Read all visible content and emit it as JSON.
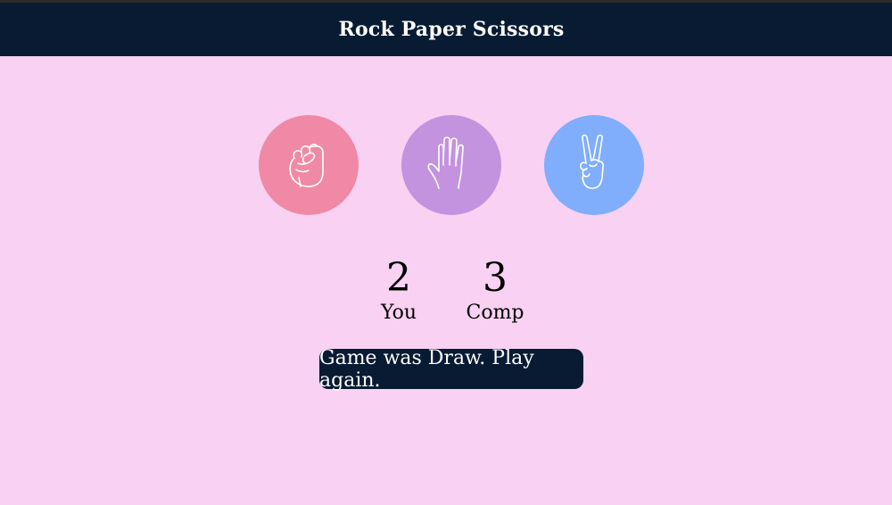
{
  "header": {
    "title": "Rock Paper Scissors"
  },
  "choices": [
    {
      "id": "rock",
      "icon": "fist-icon",
      "color": "#f089a5"
    },
    {
      "id": "paper",
      "icon": "open-hand-icon",
      "color": "#c393df"
    },
    {
      "id": "scissors",
      "icon": "peace-hand-icon",
      "color": "#80aefc"
    }
  ],
  "scoreboard": {
    "you": {
      "value": "2",
      "label": "You"
    },
    "comp": {
      "value": "3",
      "label": "Comp"
    }
  },
  "message": {
    "text": "Game was Draw. Play again."
  },
  "colors": {
    "page_bg": "#f9d1f2",
    "header_bg": "#081b33",
    "message_bg": "#081b33"
  }
}
